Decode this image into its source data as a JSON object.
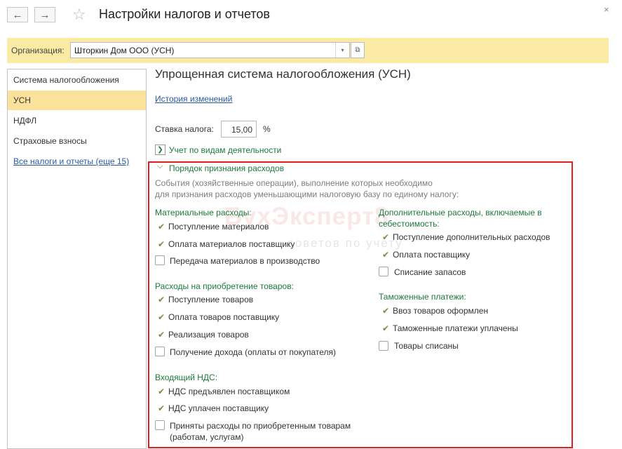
{
  "header": {
    "title": "Настройки налогов и отчетов",
    "back_icon": "←",
    "forward_icon": "→",
    "star_icon": "☆",
    "close_icon": "×"
  },
  "org": {
    "label": "Организация:",
    "value": "Шторкин Дом ООО (УСН)"
  },
  "sidebar": {
    "items": [
      {
        "label": "Система налогообложения"
      },
      {
        "label": "УСН"
      },
      {
        "label": "НДФЛ"
      },
      {
        "label": "Страховые взносы"
      },
      {
        "label": "Все налоги и отчеты (еще 15)"
      }
    ]
  },
  "main": {
    "title": "Упрощенная система налогообложения (УСН)",
    "history_link": "История изменений",
    "rate_label": "Ставка налога:",
    "rate_value": "15,00",
    "rate_unit": "%",
    "activity_label": "Учет по видам деятельности",
    "section_title": "Порядок признания расходов",
    "description_line1": "События (хозяйственные операции), выполнение которых необходимо",
    "description_line2": "для признания расходов уменьшающими налоговую базу по единому налогу:"
  },
  "groups": {
    "material": {
      "title": "Материальные расходы:",
      "items": [
        {
          "label": "Поступление материалов",
          "checked": true
        },
        {
          "label": "Оплата материалов поставщику",
          "checked": true
        },
        {
          "label": "Передача материалов в производство",
          "checked": false
        }
      ]
    },
    "goods": {
      "title": "Расходы на приобретение товаров:",
      "items": [
        {
          "label": "Поступление товаров",
          "checked": true
        },
        {
          "label": "Оплата товаров поставщику",
          "checked": true
        },
        {
          "label": "Реализация товаров",
          "checked": true
        },
        {
          "label": "Получение дохода (оплаты от покупателя)",
          "checked": false
        }
      ]
    },
    "vat": {
      "title": "Входящий НДС:",
      "items": [
        {
          "label": "НДС предъявлен поставщиком",
          "checked": true
        },
        {
          "label": "НДС уплачен поставщику",
          "checked": true
        },
        {
          "label_line1": "Приняты расходы по приобретенным товарам",
          "label_line2": "(работам, услугам)",
          "checked": false
        }
      ]
    },
    "extra": {
      "title_line1": "Дополнительные расходы, включаемые в",
      "title_line2": "себестоимость:",
      "items": [
        {
          "label": "Поступление дополнительных расходов",
          "checked": true
        },
        {
          "label": "Оплата поставщику",
          "checked": true
        },
        {
          "label": "Списание запасов",
          "checked": false
        }
      ]
    },
    "customs": {
      "title": "Таможенные платежи:",
      "items": [
        {
          "label": "Ввоз товаров оформлен",
          "checked": true
        },
        {
          "label": "Таможенные платежи уплачены",
          "checked": true
        },
        {
          "label": "Товары списаны",
          "checked": false
        }
      ]
    }
  },
  "watermark": {
    "main": "БухЭксперт8",
    "sub": "советов по учету"
  },
  "colors": {
    "accent_yellow": "#fbeaa4",
    "active_item": "#fbe29b",
    "group_green": "#1c7a3c",
    "frame_red": "#e02020",
    "link_blue": "#2a5aa6"
  },
  "icons": {
    "check": "✔",
    "chevron_down": "⌵",
    "expand_right": "❯",
    "dropdown": "▾",
    "open_form": "⧉"
  }
}
